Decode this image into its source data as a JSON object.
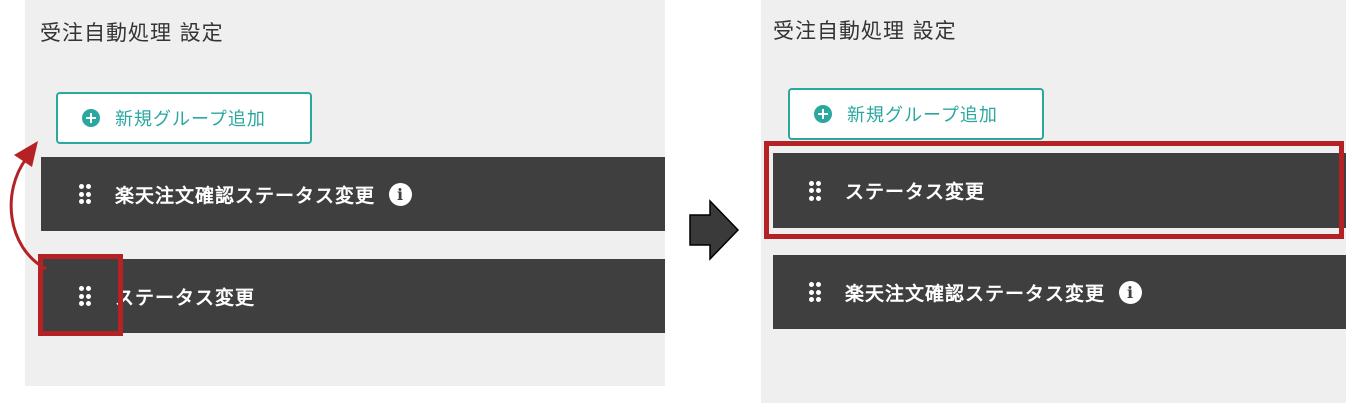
{
  "left_panel": {
    "title": "受注自動処理 設定",
    "add_button_label": "新規グループ追加",
    "groups": [
      {
        "label": "楽天注文確認ステータス変更",
        "has_info": true
      },
      {
        "label": "ステータス変更",
        "has_info": false
      }
    ]
  },
  "right_panel": {
    "title": "受注自動処理 設定",
    "add_button_label": "新規グループ追加",
    "groups": [
      {
        "label": "ステータス変更",
        "has_info": false
      },
      {
        "label": "楽天注文確認ステータス変更",
        "has_info": true
      }
    ]
  },
  "icons": {
    "add": "plus-circle-icon",
    "drag": "drag-handle-icon",
    "info": "info-icon",
    "move": "curved-arrow-icon",
    "next_step": "right-arrow-icon"
  },
  "info_glyph": "i",
  "colors": {
    "panel_bg": "#efefef",
    "row_bg": "#3f3f3f",
    "accent": "#2aa8a0",
    "highlight": "#b52226",
    "arrow": "#3a3a3a"
  }
}
